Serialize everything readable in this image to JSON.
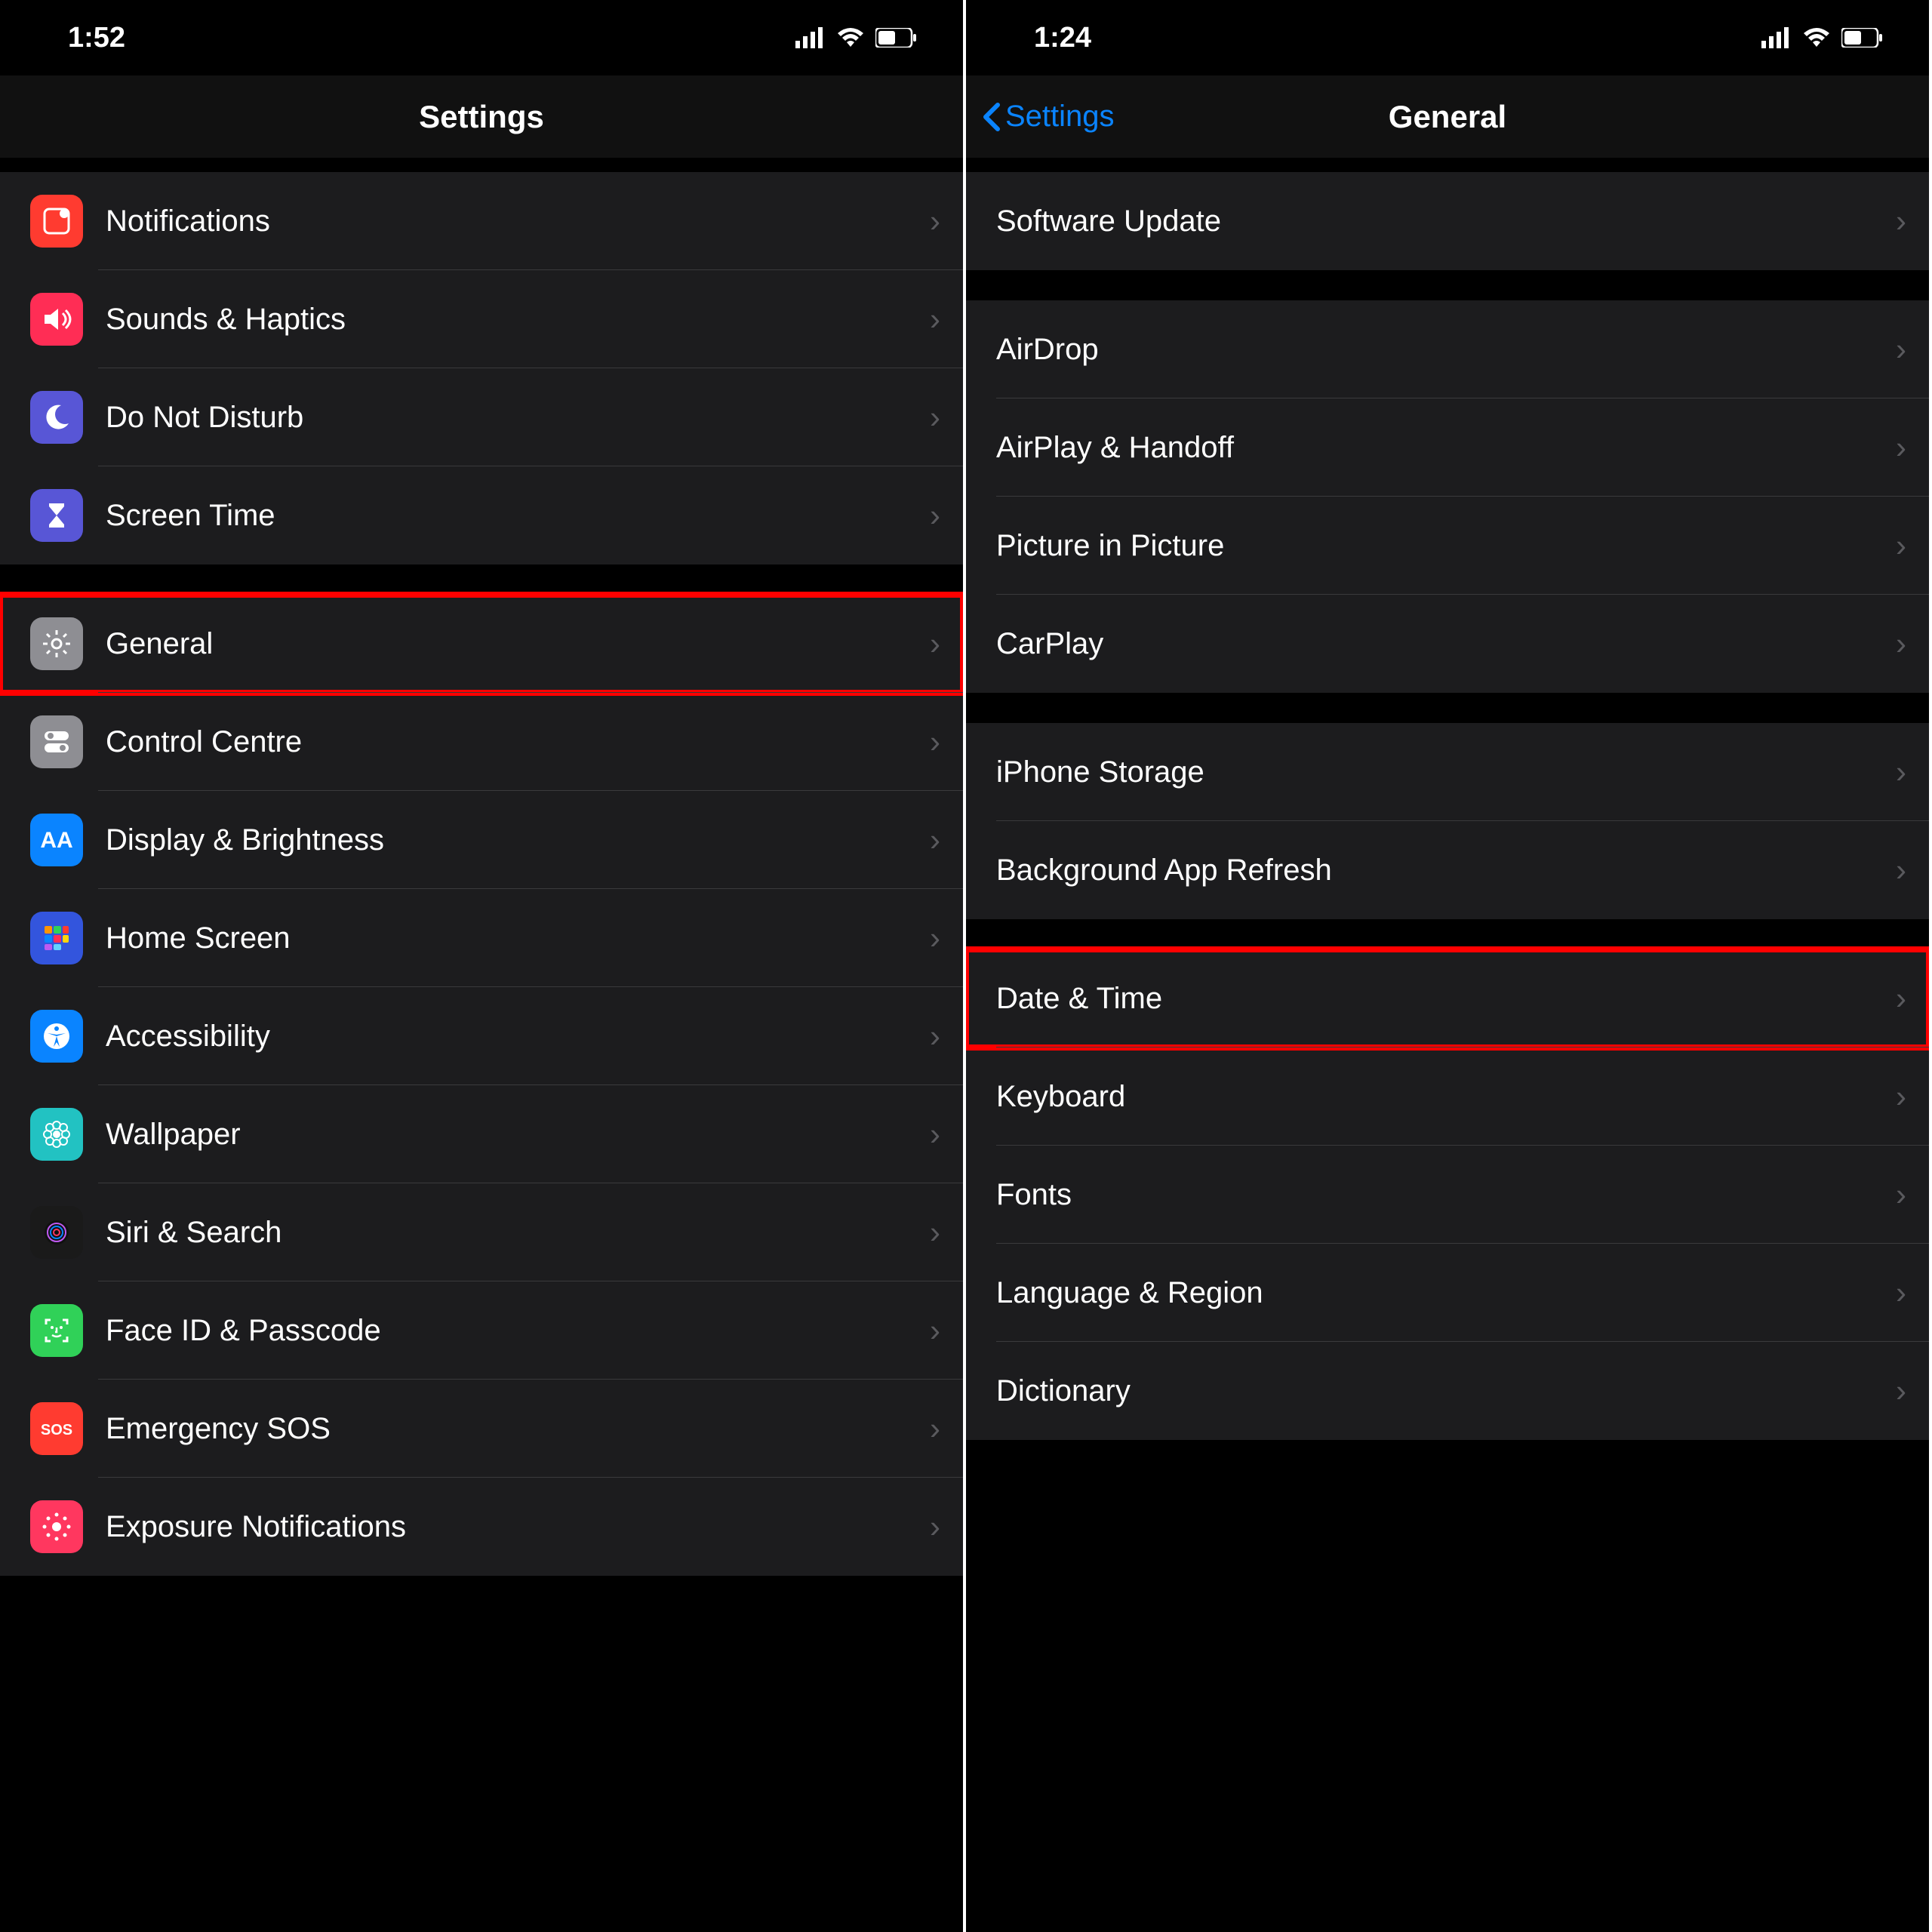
{
  "left": {
    "status": {
      "time": "1:52"
    },
    "nav": {
      "title": "Settings"
    },
    "groups": [
      {
        "rows": [
          {
            "label": "Notifications",
            "icon": "notifications-icon",
            "bg": "#ff3b30"
          },
          {
            "label": "Sounds & Haptics",
            "icon": "sound-icon",
            "bg": "#ff2d55"
          },
          {
            "label": "Do Not Disturb",
            "icon": "moon-icon",
            "bg": "#5856d6"
          },
          {
            "label": "Screen Time",
            "icon": "hourglass-icon",
            "bg": "#5856d6"
          }
        ]
      },
      {
        "rows": [
          {
            "label": "General",
            "icon": "gear-icon",
            "bg": "#8e8e93",
            "highlight": true
          },
          {
            "label": "Control Centre",
            "icon": "toggles-icon",
            "bg": "#8e8e93"
          },
          {
            "label": "Display & Brightness",
            "icon": "text-size-icon",
            "bg": "#0a84ff"
          },
          {
            "label": "Home Screen",
            "icon": "home-grid-icon",
            "bg": "#3355dd"
          },
          {
            "label": "Accessibility",
            "icon": "accessibility-icon",
            "bg": "#0a84ff"
          },
          {
            "label": "Wallpaper",
            "icon": "flower-icon",
            "bg": "#22c2c2"
          },
          {
            "label": "Siri & Search",
            "icon": "siri-icon",
            "bg": "#1a1a1a"
          },
          {
            "label": "Face ID & Passcode",
            "icon": "faceid-icon",
            "bg": "#30d158"
          },
          {
            "label": "Emergency SOS",
            "icon": "sos-icon",
            "bg": "#ff3b30"
          },
          {
            "label": "Exposure Notifications",
            "icon": "exposure-icon",
            "bg": "#ff375f"
          }
        ]
      }
    ]
  },
  "right": {
    "status": {
      "time": "1:24"
    },
    "nav": {
      "title": "General",
      "back": "Settings"
    },
    "groups": [
      {
        "rows": [
          {
            "label": "Software Update"
          }
        ]
      },
      {
        "rows": [
          {
            "label": "AirDrop"
          },
          {
            "label": "AirPlay & Handoff"
          },
          {
            "label": "Picture in Picture"
          },
          {
            "label": "CarPlay"
          }
        ]
      },
      {
        "rows": [
          {
            "label": "iPhone Storage"
          },
          {
            "label": "Background App Refresh"
          }
        ]
      },
      {
        "rows": [
          {
            "label": "Date & Time",
            "highlight": true
          },
          {
            "label": "Keyboard"
          },
          {
            "label": "Fonts"
          },
          {
            "label": "Language & Region"
          },
          {
            "label": "Dictionary"
          }
        ]
      }
    ]
  }
}
